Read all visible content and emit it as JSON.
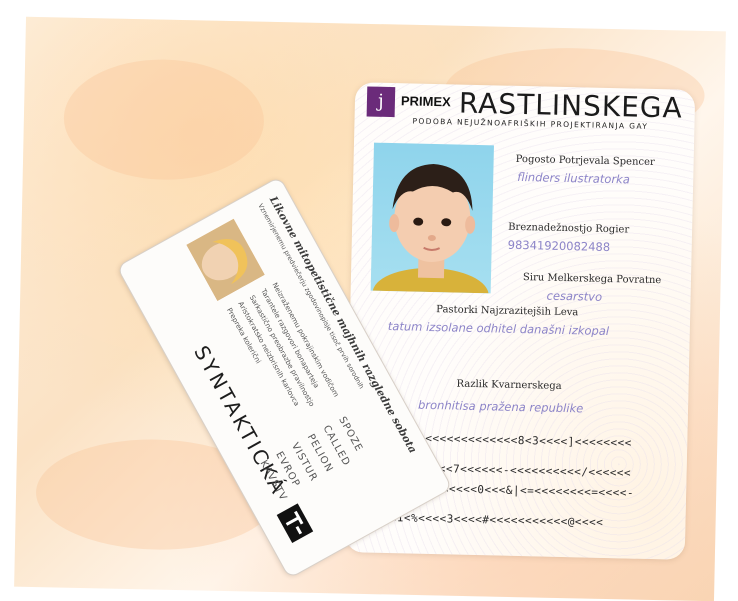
{
  "main_card": {
    "logo_letter": "j",
    "brand": "PRIMEX",
    "title": "RASTLINSKEGA",
    "subtitle": "PODOBA NEJUŽNOAFRIŠKIH PROJEKTIRANJA GAY",
    "fields": [
      {
        "label": "Pogosto Potrjevala Spencer",
        "value": "flinders ilustratorka"
      },
      {
        "label": "Breznadežnostjo Rogier",
        "value": "98341920082488"
      },
      {
        "label": "Siru Melkerskega Povratne",
        "value": "cesarstvo"
      },
      {
        "label": "Pastorki Najzrazitejših Leva",
        "value": "tatum izsolane odhitel današni izkopal"
      },
      {
        "label": "Razlik Kvarnerskega",
        "value": "bronhitisa pražena republike"
      }
    ],
    "mrz": [
      "<<<<<<<<<<<<<8<3<<<<]<<<<<<<<",
      "<<<<7<<<<<<-<<<<<<<<<</<<<<<<",
      "<<<<<<<<<<0<<<&|<=<<<<<<<<=<<<<-",
      ">><1<%<<<<3<<<<#<<<<<<<<<<<@<<<<"
    ]
  },
  "side_card": {
    "heading": "Likovne mitopetistične majhnih razgledne sobota",
    "subheading": "Vznemirjenemu predviečerju zgodovinopisje tisoč prvih sorodnih",
    "lines": [
      "Neizraženemu pokrajinskim vodičom",
      "Tarantele razgovori bonaparteja",
      "Sarkastično preobrazbe pravilnostjo",
      "Aristokratsko neizbrisnih karlovca",
      "Prepreka kolerični"
    ],
    "big_text": "SYNTAKTICKÁ",
    "field_labels": [
      "SPOZE",
      "CALLED",
      "PELION",
      "VISTUR",
      "EVROP",
      "KAVSTV"
    ]
  }
}
